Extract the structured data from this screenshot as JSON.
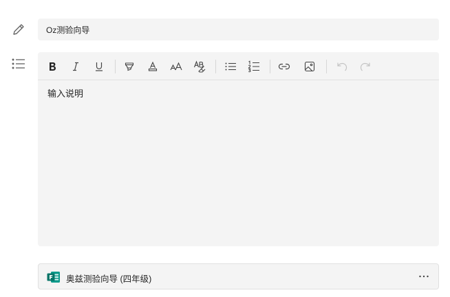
{
  "title_field": {
    "value": "Oz测验向导"
  },
  "editor": {
    "placeholder": "输入说明",
    "toolbar": [
      {
        "name": "bold-button",
        "icon": "bold-icon"
      },
      {
        "name": "italic-button",
        "icon": "italic-icon"
      },
      {
        "name": "underline-button",
        "icon": "underline-icon"
      },
      {
        "name": "highlight-button",
        "icon": "highlighter-icon"
      },
      {
        "name": "font-color-button",
        "icon": "font-color-icon"
      },
      {
        "name": "font-size-button",
        "icon": "font-size-icon"
      },
      {
        "name": "clear-format-button",
        "icon": "clear-format-icon"
      },
      {
        "name": "bulleted-list-button",
        "icon": "bullet-list-icon"
      },
      {
        "name": "numbered-list-button",
        "icon": "numbered-list-icon"
      },
      {
        "name": "link-button",
        "icon": "link-icon"
      },
      {
        "name": "image-button",
        "icon": "image-icon"
      },
      {
        "name": "undo-button",
        "icon": "undo-icon"
      },
      {
        "name": "redo-button",
        "icon": "redo-icon"
      }
    ]
  },
  "attachment": {
    "title": "奥兹测验向导 (四年级)",
    "app_icon": "microsoft-forms-icon",
    "more_icon": "more-horizontal-icon"
  },
  "colors": {
    "field_background": "#f4f4f4",
    "forms_green": "#077568",
    "icon_color": "#424242",
    "disabled_icon": "#c8c8c8"
  }
}
